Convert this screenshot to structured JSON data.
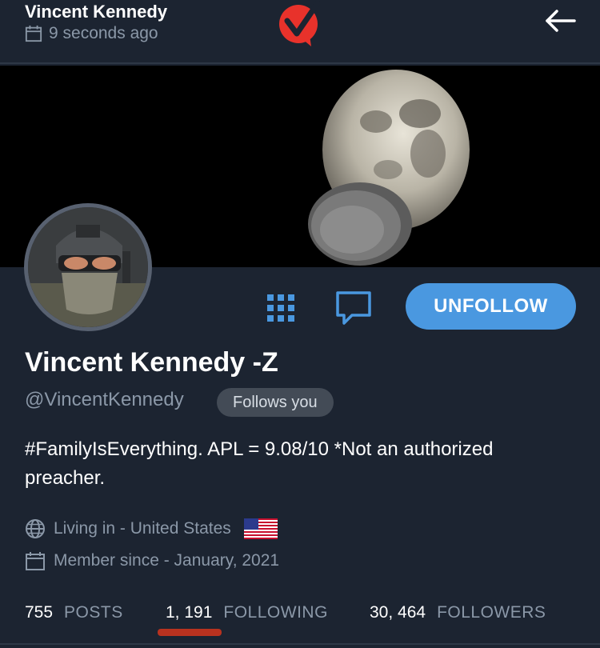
{
  "header": {
    "name": "Vincent Kennedy",
    "time": "9 seconds ago",
    "logo_color": "#e8322b"
  },
  "profile": {
    "display_name": "Vincent Kennedy -Z",
    "handle": "@VincentKennedy",
    "follows_badge": "Follows you",
    "bio": "#FamilyIsEverything. APL = 9.08/10 *Not an authorized preacher.",
    "location": "Living in - United States",
    "member_since": "Member since - January, 2021"
  },
  "actions": {
    "unfollow_label": "UNFOLLOW",
    "accent_color": "#4a98e0"
  },
  "stats": {
    "posts": {
      "value": "755",
      "label": "POSTS"
    },
    "following": {
      "value": "1, 191",
      "label": "FOLLOWING"
    },
    "followers": {
      "value": "30, 464",
      "label": "FOLLOWERS"
    }
  },
  "icons": [
    "calendar-icon",
    "logo-icon",
    "back-arrow-icon",
    "grid-icon",
    "message-icon",
    "globe-icon",
    "us-flag-icon"
  ]
}
